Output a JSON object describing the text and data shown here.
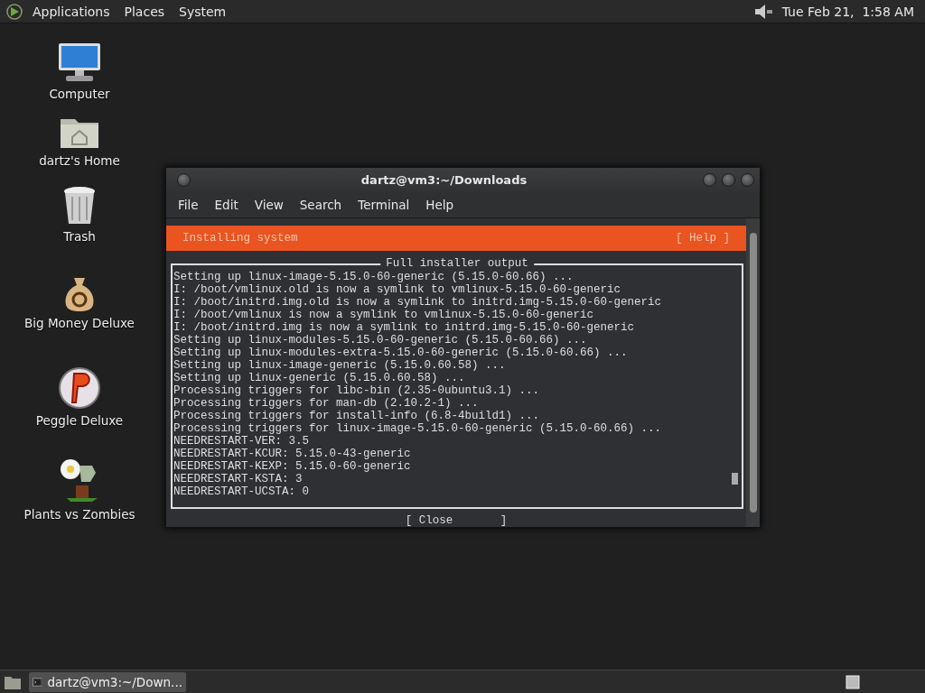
{
  "top_panel": {
    "menus": [
      "Applications",
      "Places",
      "System"
    ],
    "clock": "Tue Feb 21,  1:58 AM"
  },
  "desktop_icons": [
    {
      "kind": "computer",
      "label": "Computer"
    },
    {
      "kind": "home",
      "label": "dartz's Home"
    },
    {
      "kind": "trash",
      "label": "Trash"
    },
    {
      "kind": "money",
      "label": "Big Money Deluxe"
    },
    {
      "kind": "peggle",
      "label": "Peggle Deluxe"
    },
    {
      "kind": "plants",
      "label": "Plants vs Zombies"
    }
  ],
  "window": {
    "title": "dartz@vm3:~/Downloads",
    "menus": [
      "File",
      "Edit",
      "View",
      "Search",
      "Terminal",
      "Help"
    ],
    "installer": {
      "header": "Installing system",
      "help": "[ Help ]",
      "box_title": "Full installer output",
      "lines": [
        "Setting up linux-image-5.15.0-60-generic (5.15.0-60.66) ...",
        "I: /boot/vmlinux.old is now a symlink to vmlinux-5.15.0-60-generic",
        "I: /boot/initrd.img.old is now a symlink to initrd.img-5.15.0-60-generic",
        "I: /boot/vmlinux is now a symlink to vmlinux-5.15.0-60-generic",
        "I: /boot/initrd.img is now a symlink to initrd.img-5.15.0-60-generic",
        "Setting up linux-modules-5.15.0-60-generic (5.15.0-60.66) ...",
        "Setting up linux-modules-extra-5.15.0-60-generic (5.15.0-60.66) ...",
        "Setting up linux-image-generic (5.15.0.60.58) ...",
        "Setting up linux-generic (5.15.0.60.58) ...",
        "Processing triggers for libc-bin (2.35-0ubuntu3.1) ...",
        "Processing triggers for man-db (2.10.2-1) ...",
        "Processing triggers for install-info (6.8-4build1) ...",
        "Processing triggers for linux-image-5.15.0-60-generic (5.15.0-60.66) ...",
        "NEEDRESTART-VER: 3.5",
        "NEEDRESTART-KCUR: 5.15.0-43-generic",
        "NEEDRESTART-KEXP: 5.15.0-60-generic",
        "NEEDRESTART-KSTA: 3",
        "NEEDRESTART-UCSTA: 0"
      ],
      "close": "[ Close       ]"
    }
  },
  "taskbar": {
    "tasks": [
      {
        "label": "dartz@vm3:~/Down...",
        "selected": true
      }
    ]
  }
}
